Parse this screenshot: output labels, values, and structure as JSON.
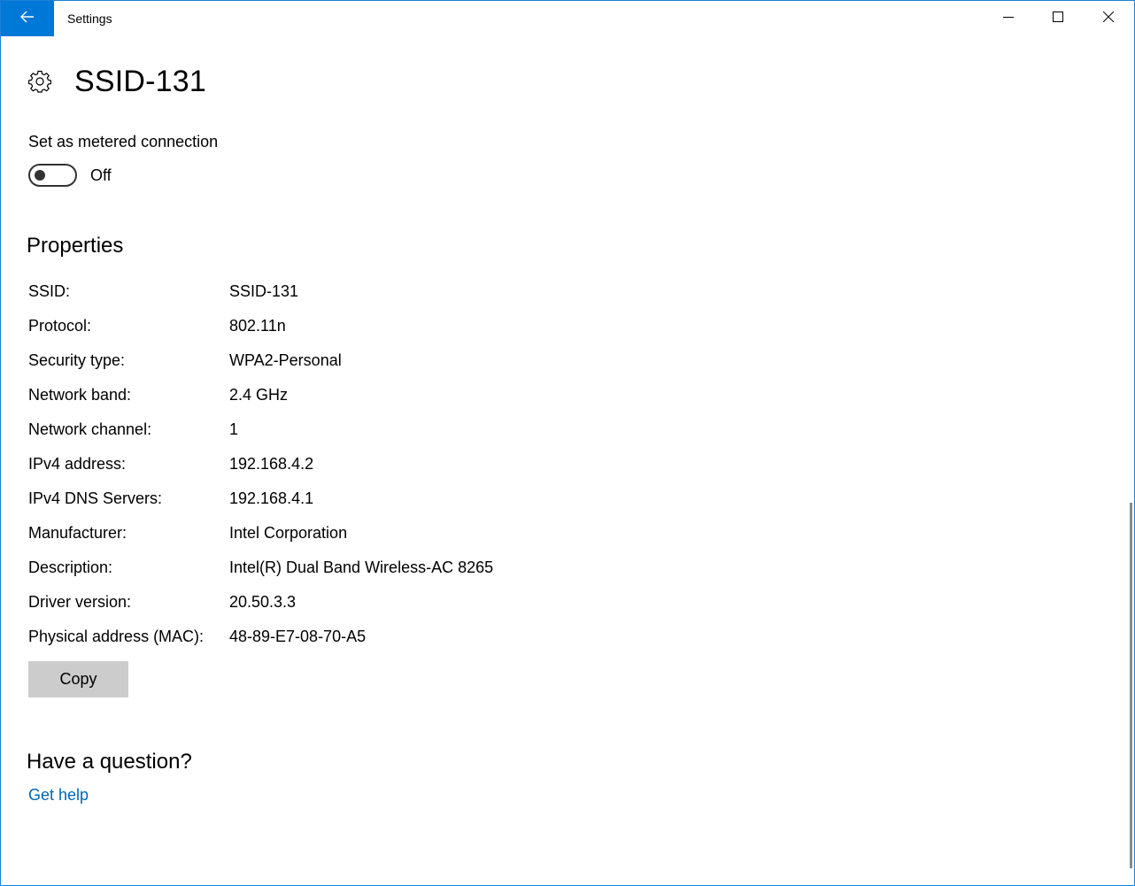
{
  "window": {
    "title": "Settings",
    "accent_color": "#0078d7",
    "back_icon": "back-arrow-icon",
    "minimize_icon": "minimize-icon",
    "maximize_icon": "maximize-icon",
    "close_icon": "close-icon"
  },
  "header": {
    "icon": "gear-icon",
    "title": "SSID-131"
  },
  "metered": {
    "label": "Set as metered connection",
    "state": "Off",
    "enabled": false
  },
  "properties": {
    "title": "Properties",
    "rows": [
      {
        "label": "SSID:",
        "value": "SSID-131"
      },
      {
        "label": "Protocol:",
        "value": "802.11n"
      },
      {
        "label": "Security type:",
        "value": "WPA2-Personal"
      },
      {
        "label": "Network band:",
        "value": "2.4 GHz"
      },
      {
        "label": "Network channel:",
        "value": "1"
      },
      {
        "label": "IPv4 address:",
        "value": "192.168.4.2"
      },
      {
        "label": "IPv4 DNS Servers:",
        "value": "192.168.4.1"
      },
      {
        "label": "Manufacturer:",
        "value": "Intel Corporation"
      },
      {
        "label": "Description:",
        "value": "Intel(R) Dual Band Wireless-AC 8265"
      },
      {
        "label": "Driver version:",
        "value": "20.50.3.3"
      },
      {
        "label": "Physical address (MAC):",
        "value": "48-89-E7-08-70-A5"
      }
    ],
    "copy_label": "Copy"
  },
  "help": {
    "title": "Have a question?",
    "link": "Get help",
    "link_color": "#0066b4"
  }
}
